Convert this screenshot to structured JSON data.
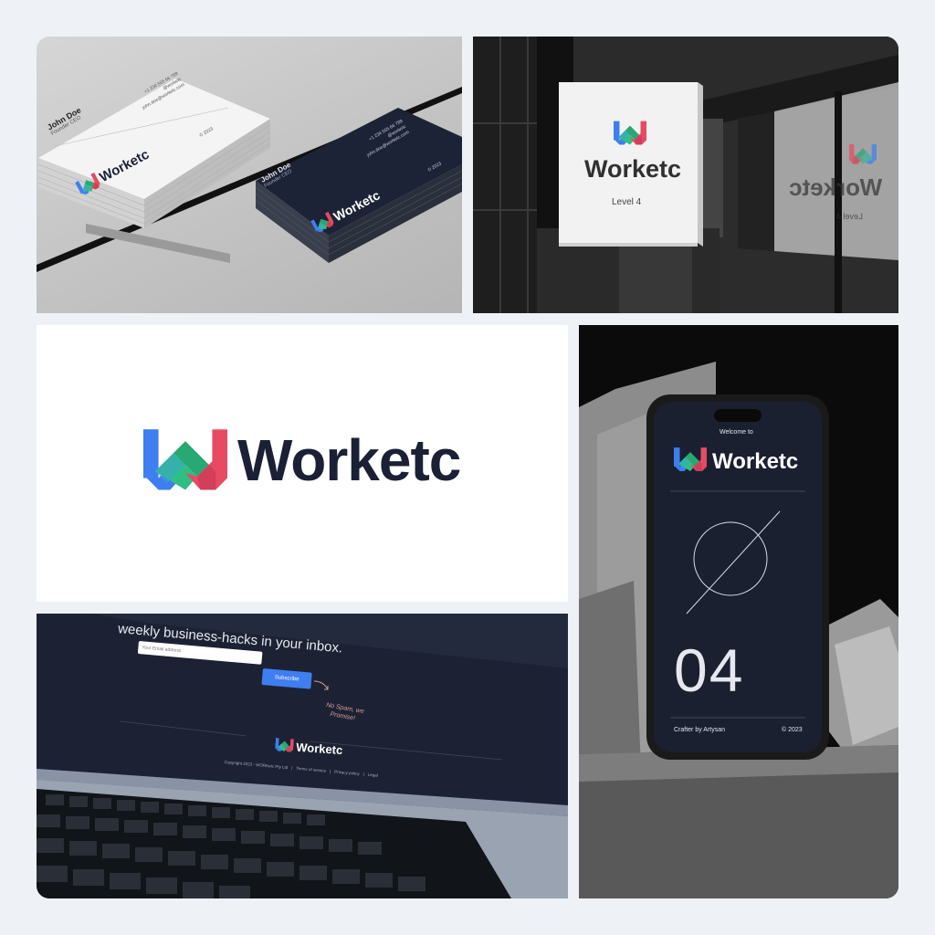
{
  "brand": {
    "name": "Worketc",
    "colors": {
      "blue": "#3f7ef0",
      "green": "#2fbf85",
      "red": "#e84a64",
      "navy": "#1b2035"
    }
  },
  "business_cards": {
    "light_card": {
      "name": "John Doe",
      "role": "Founder CEO",
      "phone": "+1 234 555 66 789",
      "handle": "@worketc",
      "email": "john.doe@worketc.com",
      "year": "© 2023"
    },
    "dark_card": {
      "name": "John Doe",
      "role": "Founder CEO",
      "phone": "+1 234 555 66 789",
      "handle": "@worketc",
      "email": "john.doe@worketc.com",
      "year": "© 2023"
    }
  },
  "storefront_sign": {
    "subtitle": "Level 4",
    "mirror_subtitle": "Level 4"
  },
  "phone_screen": {
    "welcome": "Welcome to",
    "number": "04",
    "footer_left": "Crafter by Artysan",
    "footer_right": "© 2023"
  },
  "laptop_screen": {
    "headline": "weekly business-hacks in your inbox.",
    "email_placeholder": "Your Email address",
    "subscribe_label": "Subscribe",
    "note_line1": "No Spam, we",
    "note_line2": "Promise!",
    "copyright": "Copyright 2023 - WORKetc Pty Ltd",
    "links": [
      "Terms of service",
      "Privacy policy",
      "Legal"
    ]
  }
}
